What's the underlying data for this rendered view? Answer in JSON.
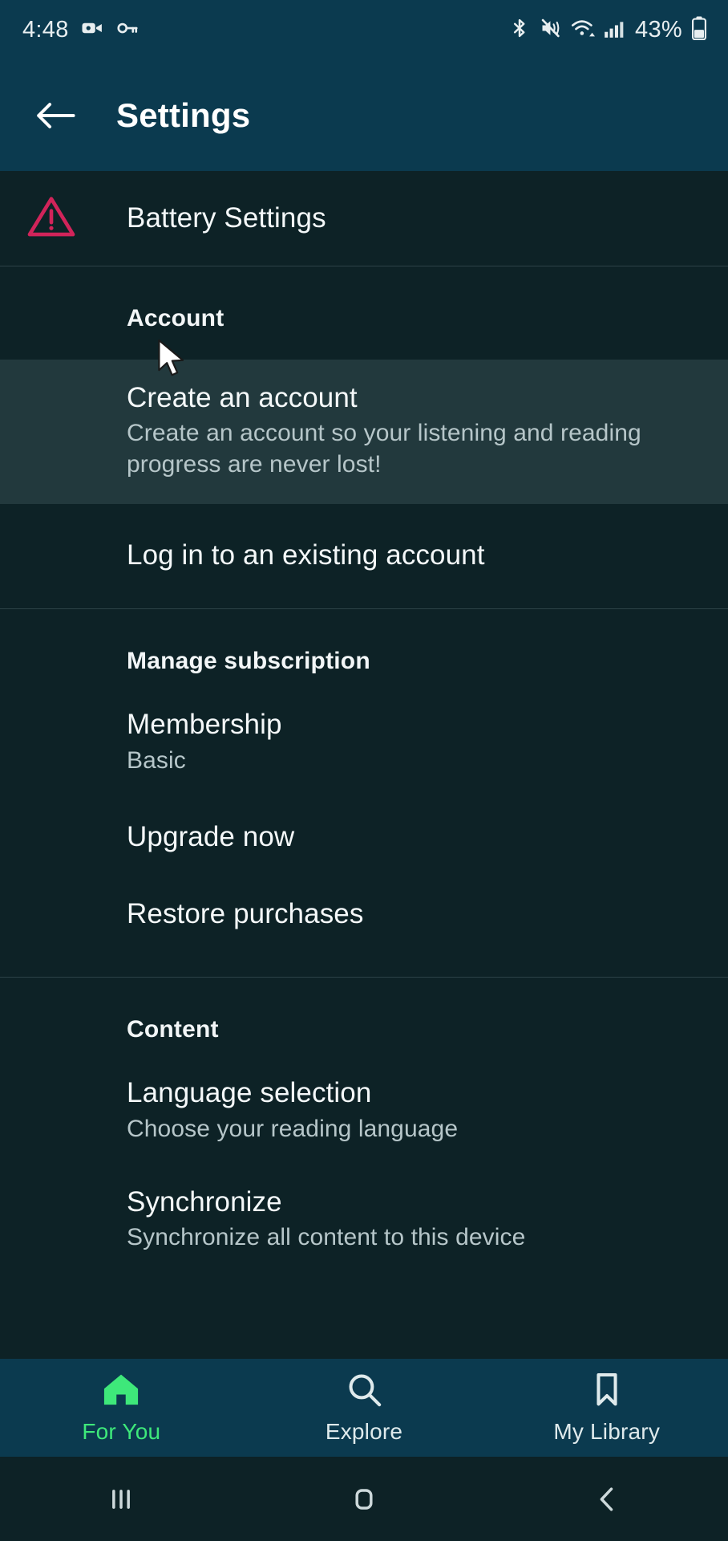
{
  "status_bar": {
    "time": "4:48",
    "battery_percent": "43%",
    "left_icons": [
      "screen-recorder-icon",
      "vpn-key-icon"
    ],
    "right_icons": [
      "bluetooth-icon",
      "volume-mute-icon",
      "wifi-icon",
      "cellular-signal-icon",
      "battery-icon"
    ]
  },
  "header": {
    "back_icon": "back-arrow-icon",
    "title": "Settings"
  },
  "battery_row": {
    "icon": "warning-triangle-icon",
    "label": "Battery Settings",
    "icon_color": "#d1245a"
  },
  "sections": [
    {
      "id": "account",
      "title": "Account",
      "items": [
        {
          "id": "create-account",
          "title": "Create an account",
          "subtitle": "Create an account so your listening and reading progress are never lost!",
          "highlighted": true
        },
        {
          "id": "log-in",
          "title": "Log in to an existing account",
          "subtitle": "",
          "highlighted": false
        }
      ]
    },
    {
      "id": "manage-subscription",
      "title": "Manage subscription",
      "items": [
        {
          "id": "membership",
          "title": "Membership",
          "subtitle": "Basic",
          "highlighted": false
        },
        {
          "id": "upgrade-now",
          "title": "Upgrade now",
          "subtitle": "",
          "highlighted": false
        },
        {
          "id": "restore-purchases",
          "title": "Restore purchases",
          "subtitle": "",
          "highlighted": false
        }
      ]
    },
    {
      "id": "content",
      "title": "Content",
      "items": [
        {
          "id": "language-selection",
          "title": "Language selection",
          "subtitle": "Choose your reading language",
          "highlighted": false
        },
        {
          "id": "synchronize",
          "title": "Synchronize",
          "subtitle": "Synchronize all content to this device",
          "highlighted": false
        }
      ]
    }
  ],
  "tabbar": {
    "active_color": "#3ee87a",
    "inactive_color": "#dfeaec",
    "tabs": [
      {
        "id": "for-you",
        "label": "For You",
        "icon": "home-icon",
        "active": true
      },
      {
        "id": "explore",
        "label": "Explore",
        "icon": "search-icon",
        "active": false
      },
      {
        "id": "my-library",
        "label": "My Library",
        "icon": "bookmark-icon",
        "active": false
      }
    ]
  },
  "system_nav": {
    "recents": "recents-icon",
    "home": "home-square-icon",
    "back": "back-chevron-icon"
  },
  "theme": {
    "header_bg": "#0b3a4f",
    "page_bg": "#0d2226",
    "highlight_bg": "#22393d",
    "divider": "#2c4247"
  }
}
